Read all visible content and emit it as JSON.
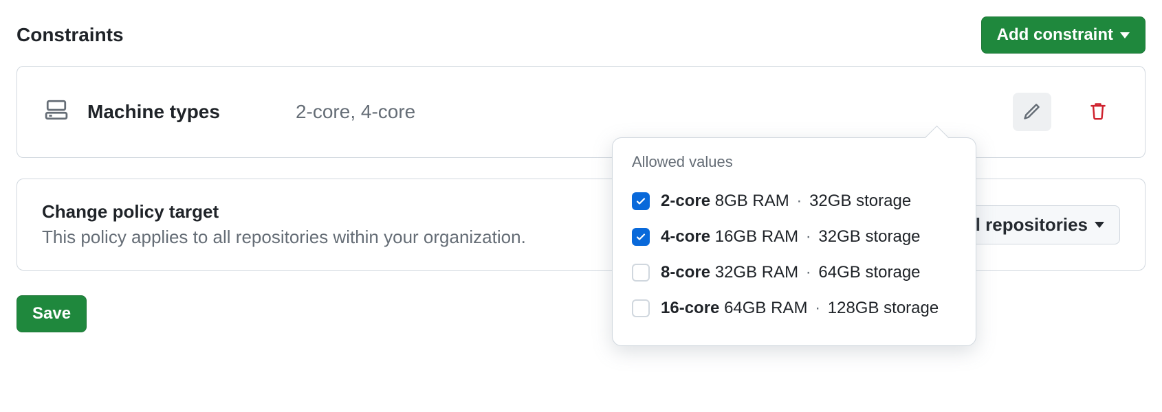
{
  "section": {
    "title": "Constraints",
    "add_button": "Add constraint"
  },
  "constraint": {
    "name": "Machine types",
    "summary": "2-core, 4-core"
  },
  "popover": {
    "title": "Allowed values",
    "options": [
      {
        "core": "2-core",
        "ram": "8GB RAM",
        "storage": "32GB storage",
        "checked": true
      },
      {
        "core": "4-core",
        "ram": "16GB RAM",
        "storage": "32GB storage",
        "checked": true
      },
      {
        "core": "8-core",
        "ram": "32GB RAM",
        "storage": "64GB storage",
        "checked": false
      },
      {
        "core": "16-core",
        "ram": "64GB RAM",
        "storage": "128GB storage",
        "checked": false
      }
    ]
  },
  "target": {
    "title": "Change policy target",
    "description": "This policy applies to all repositories within your organization.",
    "selector": "All repositories"
  },
  "footer": {
    "save": "Save"
  }
}
